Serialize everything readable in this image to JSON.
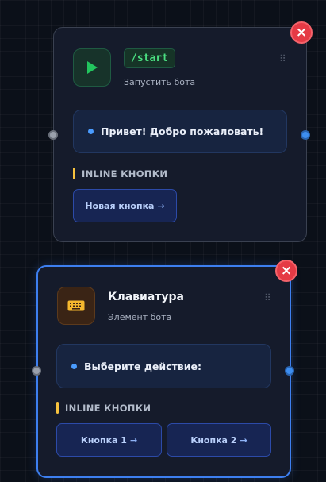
{
  "nodes": [
    {
      "command": "/start",
      "subtitle": "Запустить бота",
      "message": "Привет! Добро пожаловать!",
      "section_label": "INLINE КНОПКИ",
      "buttons": [
        {
          "label": "Новая кнопка",
          "arrow": "→"
        }
      ],
      "icon": "play-icon",
      "close": "×",
      "drag": "⠿"
    },
    {
      "title": "Клавиатура",
      "subtitle": "Элемент бота",
      "message": "Выберите действие:",
      "section_label": "INLINE КНОПКИ",
      "buttons": [
        {
          "label": "Кнопка 1",
          "arrow": "→"
        },
        {
          "label": "Кнопка 2",
          "arrow": "→"
        }
      ],
      "icon": "keyboard-icon",
      "close": "×",
      "drag": "⠿"
    }
  ],
  "colors": {
    "close": "#e53a45",
    "command": "#4ade80",
    "handle_out": "#3d8ef0",
    "section_bar": "#f6c23e",
    "selected_border": "#3d7ff0"
  }
}
